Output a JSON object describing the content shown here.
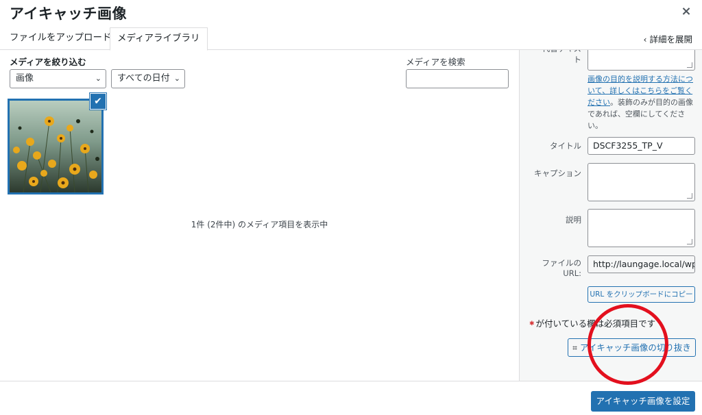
{
  "modal": {
    "title": "アイキャッチ画像",
    "close_label": "×"
  },
  "tabs": [
    {
      "label": "ファイルをアップロード",
      "active": false
    },
    {
      "label": "メディアライブラリ",
      "active": true
    }
  ],
  "expand_details": "‹ 詳細を展開",
  "filters": {
    "label": "メディアを絞り込む",
    "type_value": "画像",
    "date_value": "すべての日付"
  },
  "search": {
    "label": "メディアを検索",
    "value": ""
  },
  "media_count_text": "1件 (2件中) のメディア項目を表示中",
  "details": {
    "alt_label_partial": "代替テキスト",
    "alt_help_link": "画像の目的を説明する方法について、詳しくはこちらをご覧ください",
    "alt_help_tail": "。装飾のみが目的の画像であれば、空欄にしてください。",
    "title_label": "タイトル",
    "title_value": "DSCF3255_TP_V",
    "caption_label": "キャプション",
    "description_label": "説明",
    "file_url_label": "ファイルの URL:",
    "file_url_value": "http://laungage.local/wp-c",
    "copy_url_button": "URL をクリップボードにコピー",
    "required_note": "が付いている欄は必須項目です",
    "crop_button": "アイキャッチ画像の切り抜き"
  },
  "primary_button": "アイキャッチ画像を設定",
  "colors": {
    "accent": "#2271b1",
    "annotation": "#e3101e"
  },
  "icons": {
    "close": "close-icon",
    "check": "checkmark-icon",
    "crop": "crop-icon",
    "chevron": "chevron-down-icon"
  }
}
